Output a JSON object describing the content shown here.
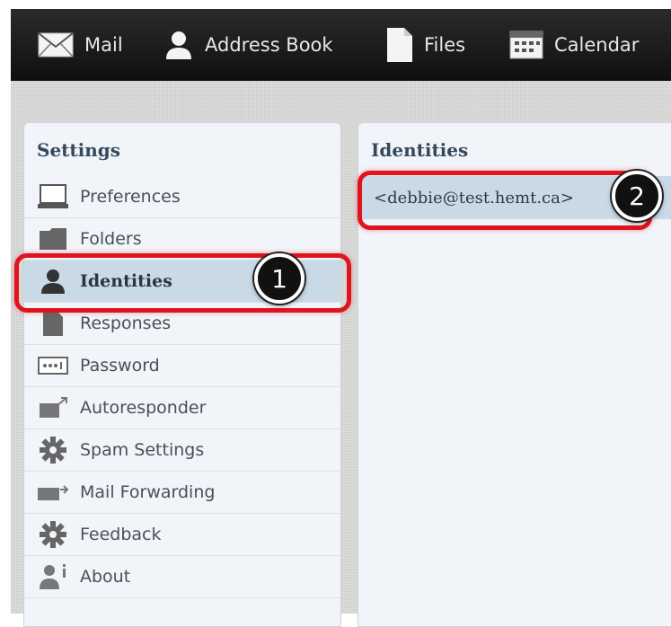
{
  "topnav": {
    "items": [
      {
        "label": "Mail",
        "icon": "envelope-icon"
      },
      {
        "label": "Address Book",
        "icon": "person-icon"
      },
      {
        "label": "Files",
        "icon": "document-icon"
      },
      {
        "label": "Calendar",
        "icon": "calendar-icon"
      }
    ]
  },
  "settings": {
    "title": "Settings",
    "items": [
      {
        "label": "Preferences",
        "icon": "monitor-icon"
      },
      {
        "label": "Folders",
        "icon": "folder-icon"
      },
      {
        "label": "Identities",
        "icon": "person-icon",
        "selected": true
      },
      {
        "label": "Responses",
        "icon": "document-icon"
      },
      {
        "label": "Password",
        "icon": "password-icon"
      },
      {
        "label": "Autoresponder",
        "icon": "autoresponder-icon"
      },
      {
        "label": "Spam Settings",
        "icon": "gear-icon"
      },
      {
        "label": "Mail Forwarding",
        "icon": "forward-icon"
      },
      {
        "label": "Feedback",
        "icon": "gear-icon"
      },
      {
        "label": "About",
        "icon": "info-person-icon"
      }
    ]
  },
  "identities": {
    "title": "Identities",
    "items": [
      {
        "label": "<debbie@test.hemt.ca>"
      }
    ]
  },
  "callouts": {
    "one": "1",
    "two": "2"
  },
  "colors": {
    "topbar": "#1a1a1a",
    "selected_row": "#c9d9e6",
    "highlight": "#e0141e",
    "title_text": "#34495e"
  }
}
